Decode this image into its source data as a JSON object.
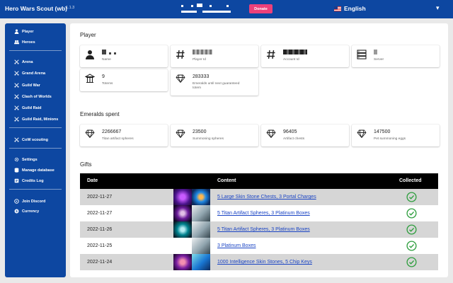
{
  "app": {
    "title": "Hero Wars Scout (wb)",
    "version": "1.1.3"
  },
  "header": {
    "donate_label": "Donate",
    "language": "English"
  },
  "sidebar": {
    "items": [
      {
        "label": "Player",
        "icon": "person-icon"
      },
      {
        "label": "Heroes",
        "icon": "group-icon"
      },
      {
        "label": "Arena",
        "icon": "swords-icon"
      },
      {
        "label": "Grand Arena",
        "icon": "swords-icon"
      },
      {
        "label": "Guild War",
        "icon": "swords-icon"
      },
      {
        "label": "Clash of Worlds",
        "icon": "swords-icon"
      },
      {
        "label": "Guild Raid",
        "icon": "swords-icon"
      },
      {
        "label": "Guild Raid, Minions",
        "icon": "swords-icon"
      },
      {
        "label": "CoW scouting",
        "icon": "swords-icon"
      },
      {
        "label": "Settings",
        "icon": "gear-icon"
      },
      {
        "label": "Manage database",
        "icon": "database-icon"
      },
      {
        "label": "Credits Log",
        "icon": "list-icon"
      },
      {
        "label": "Join Discord",
        "icon": "chat-icon"
      },
      {
        "label": "Currency",
        "icon": "currency-icon"
      }
    ]
  },
  "player": {
    "title": "Player",
    "cards": [
      {
        "label": "Name",
        "icon": "person-icon"
      },
      {
        "label": "Player Id",
        "icon": "hash-icon"
      },
      {
        "label": "Account Id",
        "icon": "hash-icon"
      },
      {
        "label": "Server",
        "icon": "server-icon"
      },
      {
        "value": "9",
        "label": "Totems",
        "icon": "temple-icon"
      },
      {
        "value": "283333",
        "label": "Emeralds until next guaranteed totem",
        "icon": "gem-icon"
      }
    ]
  },
  "emeralds": {
    "title": "Emeralds spent",
    "cards": [
      {
        "value": "2266667",
        "label": "Titan artifact spheres",
        "icon": "gem-icon"
      },
      {
        "value": "23500",
        "label": "Summoning spheres",
        "icon": "gem-icon"
      },
      {
        "value": "96405",
        "label": "Artifact chests",
        "icon": "gem-icon"
      },
      {
        "value": "147500",
        "label": "Pet summoning eggs",
        "icon": "gem-icon"
      }
    ]
  },
  "gifts": {
    "title": "Gifts",
    "columns": [
      "Date",
      "Content",
      "Collected"
    ],
    "rows": [
      {
        "date": "2022-11-27",
        "content": "5 Large Skin Stone Chests, 3 Portal Charges"
      },
      {
        "date": "2022-11-27",
        "content": "5 Titan Artifact Spheres, 3 Platinum Boxes"
      },
      {
        "date": "2022-11-26",
        "content": "5 Titan Artifact Spheres, 3 Platinum Boxes"
      },
      {
        "date": "2022-11-25",
        "content": "3 Platinum Boxes"
      },
      {
        "date": "2022-11-24",
        "content": "1000 Intelligence Skin Stones, 5 Chip Keys"
      }
    ]
  },
  "colors": {
    "primary": "#0d47a1",
    "accent": "#ec407a",
    "link": "#1a44c4",
    "check": "#2e9e3e"
  }
}
